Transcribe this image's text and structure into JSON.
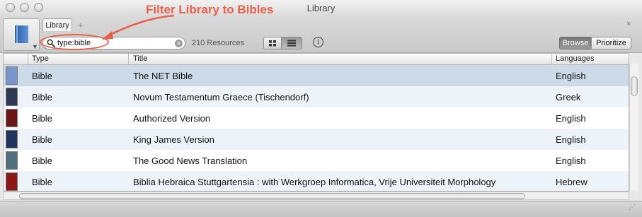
{
  "window": {
    "title": "Library"
  },
  "annotation": {
    "text": "Filter Library to Bibles",
    "color": "#e8604c"
  },
  "tabs": [
    {
      "label": "Library"
    }
  ],
  "toolbar": {
    "add_tab_label": "+",
    "close_label": "×",
    "search": {
      "value": "type:bible",
      "clear_label": "×"
    },
    "resource_count": "210 Resources",
    "info_label": "i",
    "browse_label": "Browse",
    "prioritize_label": "Prioritize"
  },
  "table": {
    "columns": [
      "Type",
      "Title",
      "Languages"
    ],
    "rows": [
      {
        "type": "Bible",
        "title": "The NET Bible",
        "language": "English",
        "cover_color": "#7895c7",
        "selected": true
      },
      {
        "type": "Bible",
        "title": "Novum Testamentum Graece (Tischendorf)",
        "language": "Greek",
        "cover_color": "#2f3a52",
        "selected": false
      },
      {
        "type": "Bible",
        "title": "Authorized Version",
        "language": "English",
        "cover_color": "#6b1717",
        "selected": false
      },
      {
        "type": "Bible",
        "title": "King James Version",
        "language": "English",
        "cover_color": "#23335e",
        "selected": false
      },
      {
        "type": "Bible",
        "title": "The Good News Translation",
        "language": "English",
        "cover_color": "#4e6f7b",
        "selected": false
      },
      {
        "type": "Bible",
        "title": "Biblia Hebraica Stuttgartensia : with Werkgroep Informatica, Vrije Universiteit Morphology",
        "language": "Hebrew",
        "cover_color": "#8a1616",
        "selected": false
      }
    ],
    "selected_row_color": "#cddbe8",
    "alt_row_color": "#eef3fa"
  }
}
